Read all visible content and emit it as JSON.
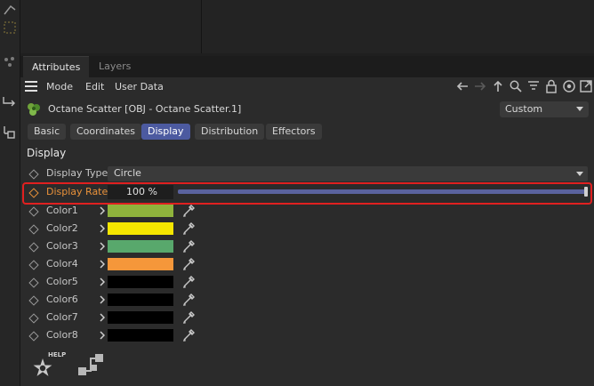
{
  "tabs": {
    "attributes": "Attributes",
    "layers": "Layers"
  },
  "menu": {
    "mode": "Mode",
    "edit": "Edit",
    "user_data": "User Data"
  },
  "object": {
    "title": "Octane Scatter [OBJ - Octane Scatter.1]",
    "dropdown_value": "Custom"
  },
  "subtabs": [
    "Basic",
    "Coordinates",
    "Display",
    "Distribution",
    "Effectors"
  ],
  "active_subtab": "Display",
  "section": {
    "title": "Display"
  },
  "display_type": {
    "label": "Display Type",
    "value": "Circle"
  },
  "display_rate": {
    "label": "Display Rate",
    "value": "100 %",
    "fraction": 1.0
  },
  "colors": [
    {
      "label": "Color1",
      "hex": "#8fb33c"
    },
    {
      "label": "Color2",
      "hex": "#f5e600"
    },
    {
      "label": "Color3",
      "hex": "#58a86c"
    },
    {
      "label": "Color4",
      "hex": "#f5973a"
    },
    {
      "label": "Color5",
      "hex": "#000000"
    },
    {
      "label": "Color6",
      "hex": "#000000"
    },
    {
      "label": "Color7",
      "hex": "#000000"
    },
    {
      "label": "Color8",
      "hex": "#000000"
    }
  ],
  "bottom": {
    "help_badge": "HELP"
  },
  "accent": {
    "highlight_red": "#e02020",
    "active_tab": "#4c5aa0",
    "slider": "#5a629e",
    "label_orange": "#e8913a"
  }
}
